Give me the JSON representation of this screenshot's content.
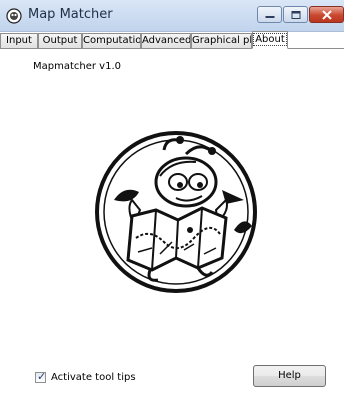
{
  "window": {
    "title": "Map Matcher"
  },
  "tabs": [
    {
      "label": "Input"
    },
    {
      "label": "Output"
    },
    {
      "label": "Computation"
    },
    {
      "label": "Advanced"
    },
    {
      "label": "Graphical plot"
    },
    {
      "label": "About",
      "active": true
    }
  ],
  "about": {
    "version_text": "Mapmatcher v1.0",
    "logo_icon": "bug-reading-map-logo"
  },
  "footer": {
    "tooltips_label": "Activate tool tips",
    "tooltips_checked": true,
    "help_label": "Help"
  },
  "colors": {
    "titlebar": "#c9daf0",
    "close_button": "#c9482f"
  }
}
